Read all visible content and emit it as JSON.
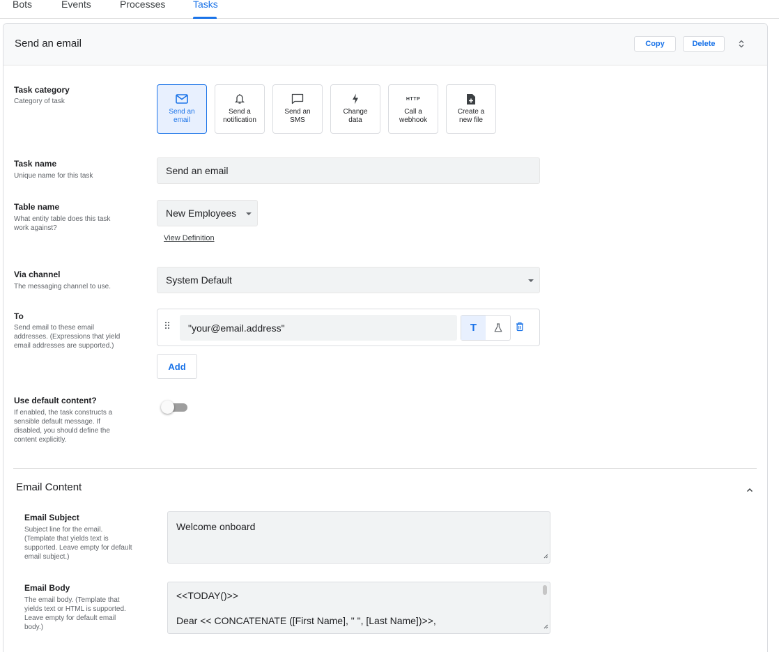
{
  "top_tabs": [
    {
      "label": "Bots"
    },
    {
      "label": "Events"
    },
    {
      "label": "Processes"
    },
    {
      "label": "Tasks",
      "active": true
    }
  ],
  "card": {
    "title": "Send an email",
    "copy_label": "Copy",
    "delete_label": "Delete"
  },
  "task_category": {
    "label": "Task category",
    "description": "Category of task",
    "options": [
      {
        "line1": "Send an",
        "line2": "email",
        "icon": "mail-icon",
        "selected": true
      },
      {
        "line1": "Send a",
        "line2": "notification",
        "icon": "bell-icon"
      },
      {
        "line1": "Send an",
        "line2": "SMS",
        "icon": "message-icon"
      },
      {
        "line1": "Change",
        "line2": "data",
        "icon": "bolt-icon"
      },
      {
        "line1": "Call a",
        "line2": "webhook",
        "icon": "http-icon",
        "icon_text": "HTTP"
      },
      {
        "line1": "Create a",
        "line2": "new file",
        "icon": "file-add-icon"
      }
    ]
  },
  "task_name": {
    "label": "Task name",
    "description": "Unique name for this task",
    "value": "Send an email"
  },
  "table_name": {
    "label": "Table name",
    "description_1": "What entity table does this task",
    "description_2": "work against?",
    "value": "New Employees",
    "link": "View Definition"
  },
  "via_channel": {
    "label": "Via channel",
    "description": "The messaging channel to use.",
    "value": "System Default"
  },
  "to": {
    "label": "To",
    "description_1": "Send email to these email",
    "description_2": "addresses. (Expressions that yield",
    "description_3": "email addresses are supported.)",
    "value": "\"your@email.address\"",
    "text_mode_label": "T",
    "add_label": "Add"
  },
  "default_content": {
    "label": "Use default content?",
    "description_1": "If enabled, the task constructs a",
    "description_2": "sensible default message. If",
    "description_3": "disabled, you should define the",
    "description_4": "content explicitly.",
    "enabled": false
  },
  "email_content": {
    "title": "Email Content",
    "subject": {
      "label": "Email Subject",
      "description_1": "Subject line for the email.",
      "description_2": "(Template that yields text is",
      "description_3": "supported. Leave empty for default",
      "description_4": "email subject.)",
      "value": "Welcome onboard"
    },
    "body": {
      "label": "Email Body",
      "description_1": "The email body. (Template that",
      "description_2": "yields text or HTML is supported.",
      "description_3": "Leave empty for default email",
      "description_4": "body.)",
      "line_1": "<<TODAY()>>",
      "line_2": "Dear << CONCATENATE ([First Name], \" \", [Last Name])>>,"
    }
  },
  "colors": {
    "accent": "#1a73e8",
    "selected_bg": "#e8f0fe",
    "field_bg": "#f1f3f4"
  }
}
